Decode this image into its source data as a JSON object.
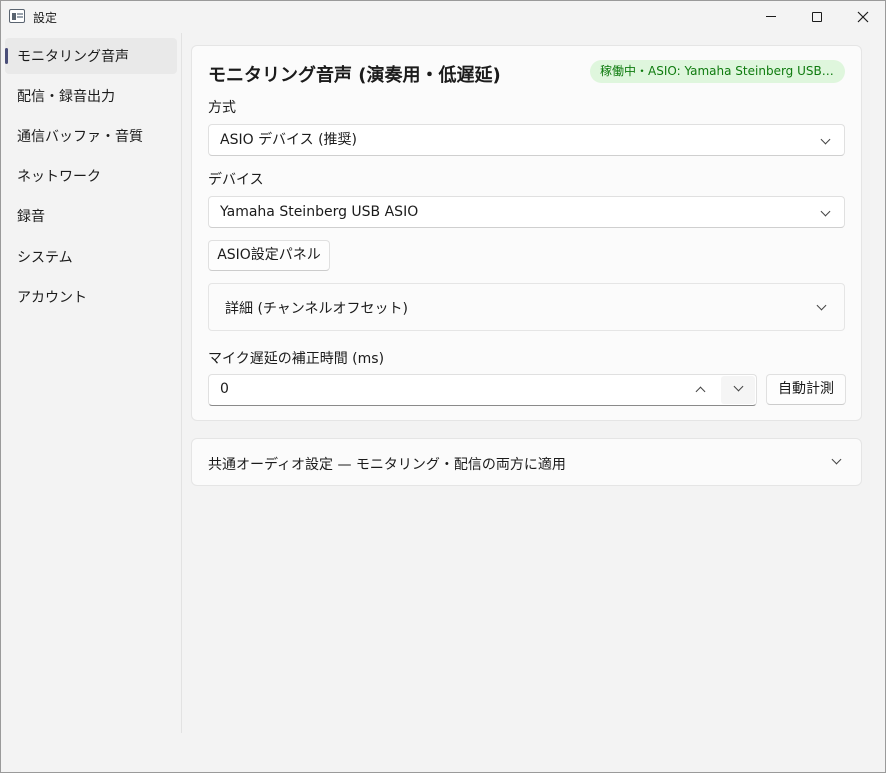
{
  "window": {
    "title": "設定",
    "controls": {
      "minimize": "minimize-icon",
      "maximize": "maximize-icon",
      "close": "close-icon"
    }
  },
  "sidebar": {
    "items": [
      {
        "label": "モニタリング音声",
        "active": true
      },
      {
        "label": "配信・録音出力"
      },
      {
        "label": "通信バッファ・音質"
      },
      {
        "label": "ネットワーク"
      },
      {
        "label": "録音"
      },
      {
        "label": "システム"
      },
      {
        "label": "アカウント"
      }
    ]
  },
  "monitoring": {
    "title": "モニタリング音声 (演奏用・低遅延)",
    "status": "稼働中・ASIO: Yamaha Steinberg USB ASIO",
    "mode_label": "方式",
    "mode_value": "ASIO デバイス (推奨)",
    "device_label": "デバイス",
    "device_value": "Yamaha Steinberg USB ASIO",
    "asio_panel_button": "ASIO設定パネル",
    "details_expander": "詳細 (チャンネルオフセット)",
    "mic_delay_label": "マイク遅延の補正時間 (ms)",
    "mic_delay_value": "0",
    "auto_measure_button": "自動計測"
  },
  "common_audio": {
    "label": "共通オーディオ設定 — モニタリング・配信の両方に適用"
  },
  "colors": {
    "status_bg": "#dff6dd",
    "status_text": "#0f7b0f",
    "nav_indicator": "#4a4e78"
  }
}
